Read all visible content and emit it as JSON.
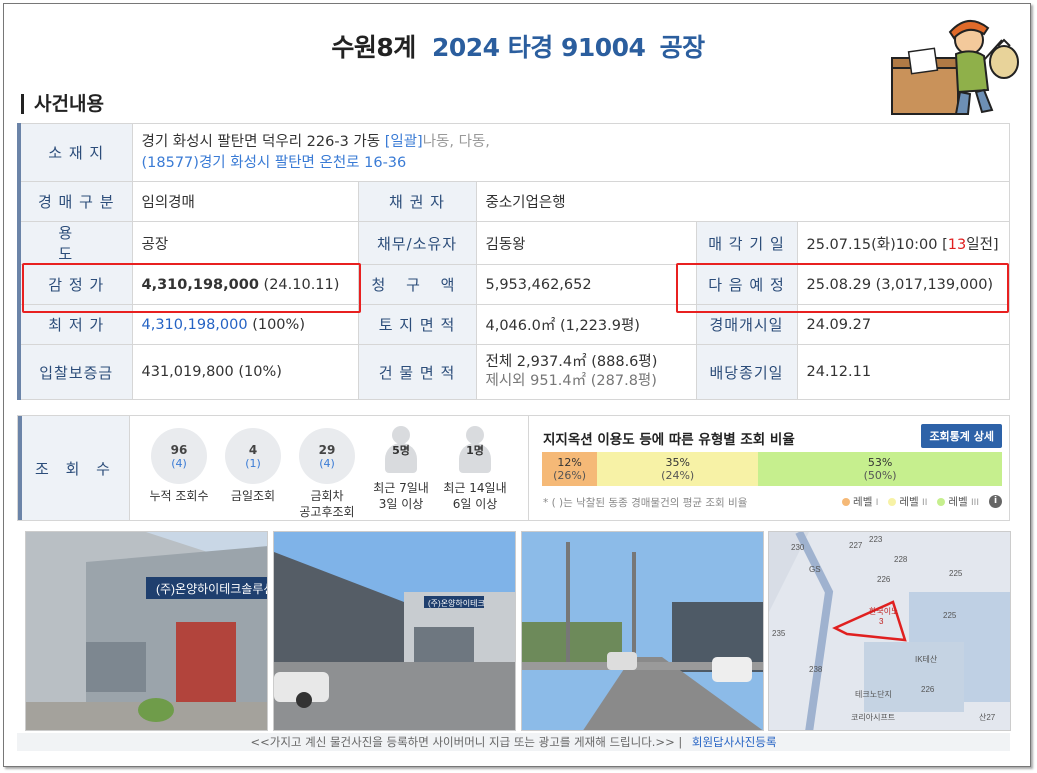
{
  "header": {
    "court": "수원8계",
    "case_no": "2024 타경 91004",
    "type": "공장"
  },
  "section_title": "사건내용",
  "info": {
    "location": {
      "label": "소 재 지",
      "line1": "경기 화성시 팔탄면 덕우리 226-3 가동",
      "line1_link": "[일괄]",
      "line1_tail": "나동, 다동,",
      "line2": "(18577)경기 화성시  팔탄면 온천로  16-36"
    },
    "auction_type": {
      "label": "경 매 구 분",
      "value": "임의경매"
    },
    "creditor": {
      "label": "채 권 자",
      "value": "중소기업은행"
    },
    "usage": {
      "label": "용 도",
      "value": "공장"
    },
    "debtor": {
      "label": "채무/소유자",
      "value": "김동왕"
    },
    "sale_date": {
      "label": "매 각 기 일",
      "value": "25.07.15(화)10:00 [",
      "days": "13",
      "days_tail": "일전]"
    },
    "appraisal": {
      "label": "감 정 가",
      "amount": "4,310,198,000",
      "date": "(24.10.11)"
    },
    "claim": {
      "label": "청 구 액",
      "value": "5,953,462,652"
    },
    "next": {
      "label": "다 음 예 정",
      "value": "25.08.29 (3,017,139,000)"
    },
    "minimum": {
      "label": "최 저 가",
      "amount": "4,310,198,000",
      "pct": "(100%)"
    },
    "land_area": {
      "label": "토 지 면 적",
      "value": "4,046.0㎡ (1,223.9평)"
    },
    "start_date": {
      "label": "경매개시일",
      "value": "24.09.27"
    },
    "deposit": {
      "label": "입찰보증금",
      "value": "431,019,800 (10%)"
    },
    "building_area": {
      "label": "건 물 면 적",
      "line1": "전체 2,937.4㎡ (888.6평)",
      "line2": "제시외 951.4㎡ (287.8평)"
    },
    "dividend_date": {
      "label": "배당종기일",
      "value": "24.12.11"
    }
  },
  "views": {
    "label": "조 회 수",
    "stats": [
      {
        "num": "96",
        "sub": "(4)",
        "cap1": "누적 조회수",
        "cap2": ""
      },
      {
        "num": "4",
        "sub": "(1)",
        "cap1": "금일조회",
        "cap2": ""
      },
      {
        "num": "29",
        "sub": "(4)",
        "cap1": "금회차",
        "cap2": "공고후조회"
      }
    ],
    "people": [
      {
        "num": "5명",
        "cap1": "최근 7일내",
        "cap2": "3일 이상"
      },
      {
        "num": "1명",
        "cap1": "최근 14일내",
        "cap2": "6일 이상"
      }
    ],
    "ratio_title": "지지옥션 이용도 등에 따른 유형별 조회 비율",
    "detail_button": "조회통계 상세",
    "note": "* ( )는 낙찰된 동종 경매물건의 평균 조회 비율",
    "legend": [
      "레벨",
      "레벨",
      "레벨"
    ],
    "legend_roman": [
      "I",
      "II",
      "III"
    ],
    "colors": {
      "level1": "#f5b977",
      "level2": "#f7f2a6",
      "level3": "#c6ef8e"
    }
  },
  "chart_data": {
    "type": "bar",
    "categories": [
      "레벨 I",
      "레벨 II",
      "레벨 III"
    ],
    "series": [
      {
        "values": [
          12,
          35,
          53
        ]
      },
      {
        "values": [
          26,
          24,
          50
        ]
      }
    ],
    "labels": [
      "12%",
      "35%",
      "53%"
    ],
    "sub_labels": [
      "(26%)",
      "(24%)",
      "(50%)"
    ]
  },
  "photos": [
    {
      "sign": "(주)온양하이테크솔루션"
    },
    {
      "sign": "(주)온양하이테크"
    },
    {
      "sign": ""
    },
    {
      "sign": ""
    }
  ],
  "map": {
    "labels": [
      "230",
      "227",
      "223",
      "228",
      "226",
      "225",
      "GS",
      "235",
      "238",
      "226",
      "225",
      "IK테산",
      "테크노단지",
      "코리아시프트",
      "산27",
      "한국이노",
      "3"
    ]
  },
  "footer": {
    "text": "<<가지고 계신 물건사진을 등록하면 사이버머니 지급 또는 광고를 게재해 드립니다.>>  |",
    "link": "회원답사사진등록"
  }
}
